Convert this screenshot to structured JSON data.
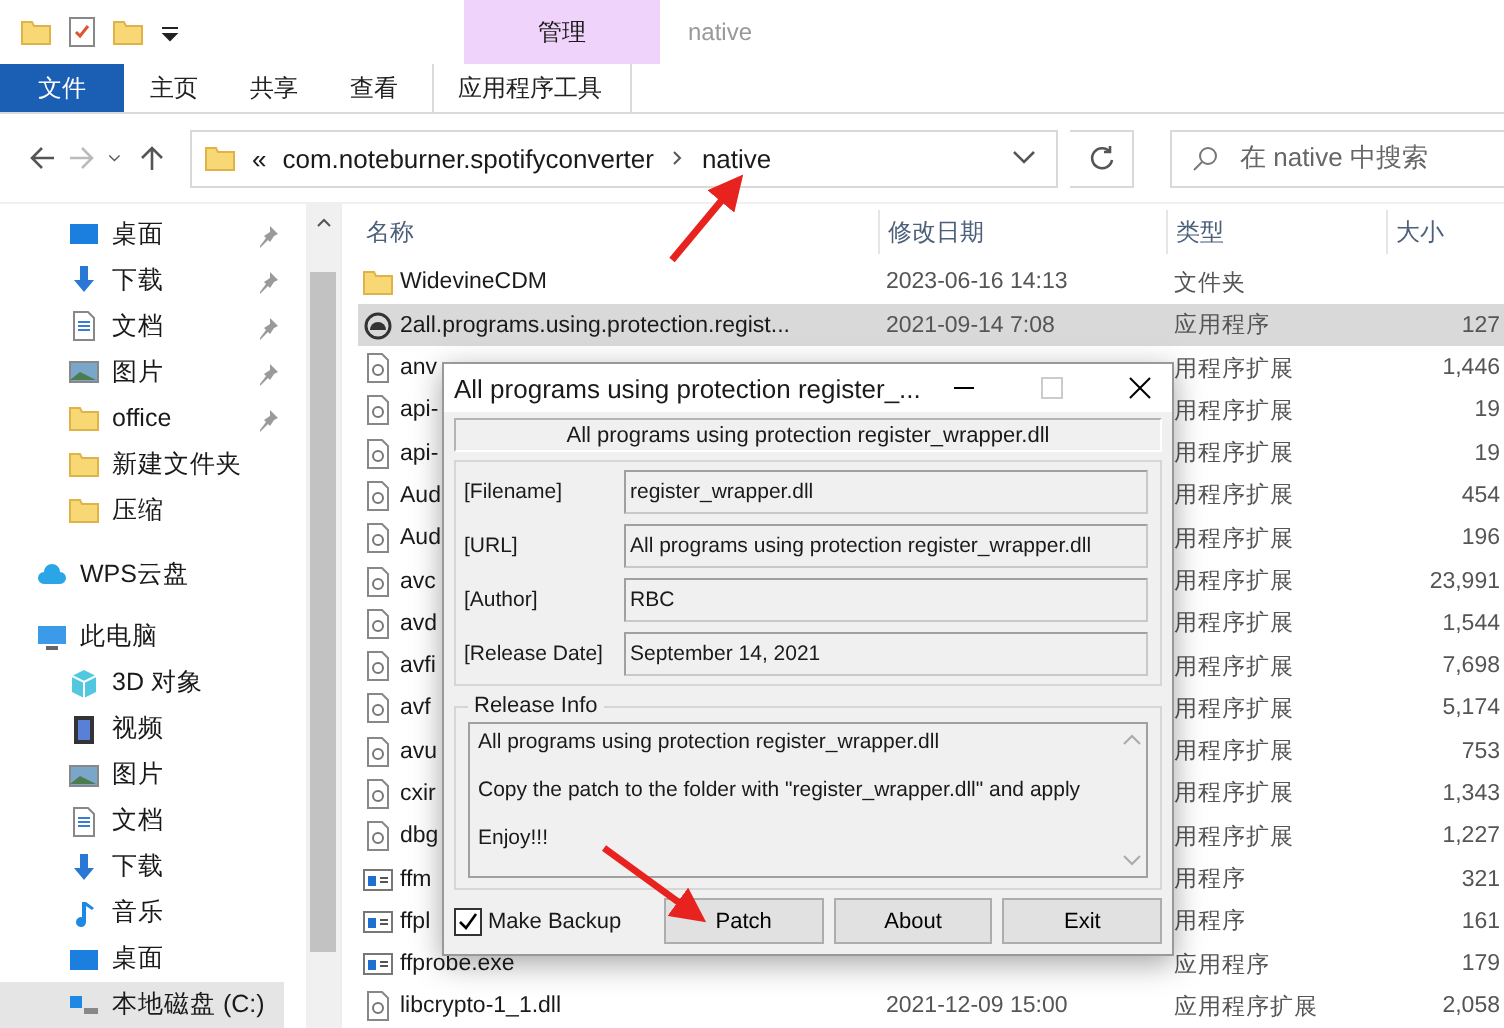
{
  "ribbon": {
    "context_group": "管理",
    "title": "native",
    "tabs": [
      {
        "label": "文件",
        "kind": "file"
      },
      {
        "label": "主页",
        "kind": "tab"
      },
      {
        "label": "共享",
        "kind": "tab"
      },
      {
        "label": "查看",
        "kind": "tab"
      },
      {
        "label": "应用程序工具",
        "kind": "context"
      }
    ]
  },
  "address": {
    "overflow": "«",
    "path": [
      "com.noteburner.spotifyconverter",
      "native"
    ]
  },
  "search": {
    "placeholder": "在 native 中搜索"
  },
  "sidebar": {
    "items": [
      {
        "label": "桌面",
        "kind": "desktop",
        "pinned": true,
        "selected": false
      },
      {
        "label": "下载",
        "kind": "download",
        "pinned": true,
        "selected": false
      },
      {
        "label": "文档",
        "kind": "document",
        "pinned": true,
        "selected": false
      },
      {
        "label": "图片",
        "kind": "pictures",
        "pinned": true,
        "selected": false
      },
      {
        "label": "office",
        "kind": "folder",
        "pinned": true,
        "selected": false
      },
      {
        "label": "新建文件夹",
        "kind": "folder",
        "pinned": false,
        "selected": false
      },
      {
        "label": "压缩",
        "kind": "folder",
        "pinned": false,
        "selected": false
      },
      {
        "label": "WPS云盘",
        "kind": "cloud",
        "pinned": false,
        "selected": false
      },
      {
        "label": "此电脑",
        "kind": "pc",
        "pinned": false,
        "selected": false,
        "children": [
          {
            "label": "3D 对象",
            "kind": "cube",
            "pinned": false,
            "selected": false
          },
          {
            "label": "视频",
            "kind": "video",
            "pinned": false,
            "selected": false
          },
          {
            "label": "图片",
            "kind": "pictures",
            "pinned": false,
            "selected": false
          },
          {
            "label": "文档",
            "kind": "document",
            "pinned": false,
            "selected": false
          },
          {
            "label": "下载",
            "kind": "download",
            "pinned": false,
            "selected": false
          },
          {
            "label": "音乐",
            "kind": "music",
            "pinned": false,
            "selected": false
          },
          {
            "label": "桌面",
            "kind": "desktop",
            "pinned": false,
            "selected": false
          },
          {
            "label": "本地磁盘 (C:)",
            "kind": "drive",
            "pinned": false,
            "selected": true
          }
        ]
      }
    ]
  },
  "files": {
    "columns": [
      "名称",
      "修改日期",
      "类型",
      "大小"
    ],
    "rows": [
      {
        "name": "WidevineCDM",
        "date": "2023-06-16 14:13",
        "type": "文件夹",
        "kind": "folder",
        "selected": false
      },
      {
        "name": "2all.programs.using.protection.regist...",
        "date": "2021-09-14 7:08",
        "type": "应用程序",
        "size": "127",
        "kind": "app",
        "selected": true
      },
      {
        "name": "anv",
        "type": "用程序扩展",
        "size": "1,446",
        "kind": "dll",
        "selected": false
      },
      {
        "name": "api-",
        "type": "用程序扩展",
        "size": "19",
        "kind": "dll",
        "selected": false
      },
      {
        "name": "api-",
        "type": "用程序扩展",
        "size": "19",
        "kind": "dll",
        "selected": false
      },
      {
        "name": "Aud",
        "type": "用程序扩展",
        "size": "454",
        "kind": "dll",
        "selected": false
      },
      {
        "name": "Aud",
        "type": "用程序扩展",
        "size": "196",
        "kind": "dll",
        "selected": false
      },
      {
        "name": "avc",
        "type": "用程序扩展",
        "size": "23,991",
        "kind": "dll",
        "selected": false
      },
      {
        "name": "avd",
        "type": "用程序扩展",
        "size": "1,544",
        "kind": "dll",
        "selected": false
      },
      {
        "name": "avfi",
        "type": "用程序扩展",
        "size": "7,698",
        "kind": "dll",
        "selected": false
      },
      {
        "name": "avf",
        "type": "用程序扩展",
        "size": "5,174",
        "kind": "dll",
        "selected": false
      },
      {
        "name": "avu",
        "type": "用程序扩展",
        "size": "753",
        "kind": "dll",
        "selected": false
      },
      {
        "name": "cxir",
        "type": "用程序扩展",
        "size": "1,343",
        "kind": "dll",
        "selected": false
      },
      {
        "name": "dbg",
        "type": "用程序扩展",
        "size": "1,227",
        "kind": "dll",
        "selected": false
      },
      {
        "name": "ffm",
        "type": "用程序",
        "size": "321",
        "kind": "exe",
        "selected": false
      },
      {
        "name": "ffpl",
        "type": "用程序",
        "size": "161",
        "kind": "exe",
        "selected": false
      },
      {
        "name": "ffprobe.exe",
        "type": "应用程序",
        "size": "179",
        "kind": "exe",
        "selected": false
      },
      {
        "name": "libcrypto-1_1.dll",
        "date": "2021-12-09 15:00",
        "type": "应用程序扩展",
        "size": "2,058",
        "kind": "dll",
        "selected": false
      }
    ]
  },
  "dialog": {
    "title": "All programs using protection register_...",
    "banner": "All programs using protection register_wrapper.dll",
    "fields": [
      {
        "label": "[Filename]",
        "value": "register_wrapper.dll"
      },
      {
        "label": "[URL]",
        "value": "All programs using protection register_wrapper.dll"
      },
      {
        "label": "[Author]",
        "value": "RBC"
      },
      {
        "label": "[Release Date]",
        "value": "September 14, 2021"
      }
    ],
    "release_info": {
      "title": "Release Info",
      "lines": [
        "All programs using protection register_wrapper.dll",
        "Copy the patch to the folder with \"register_wrapper.dll\" and apply",
        "Enjoy!!!"
      ]
    },
    "backup": {
      "label": "Make Backup",
      "checked": true
    },
    "buttons": [
      "Patch",
      "About",
      "Exit"
    ]
  }
}
